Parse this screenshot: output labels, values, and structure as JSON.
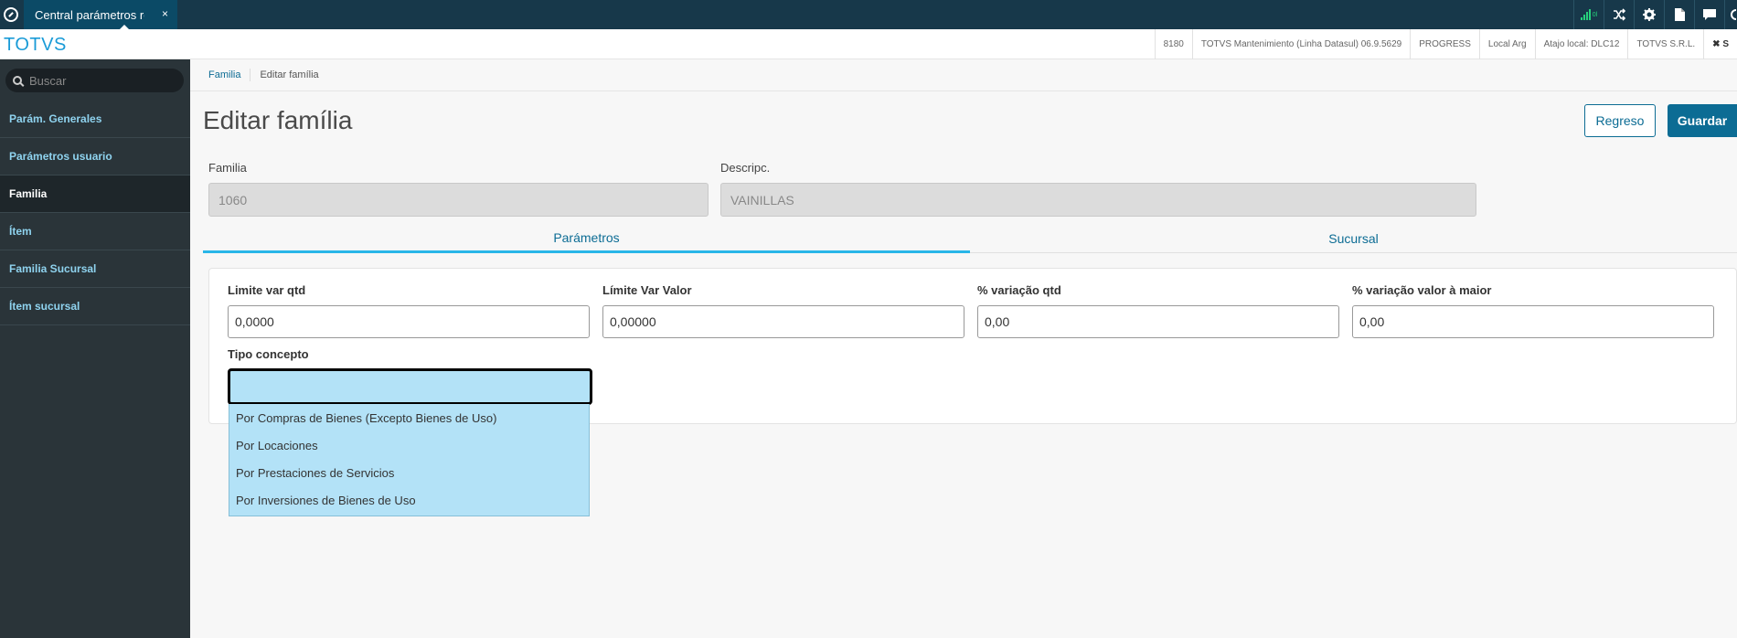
{
  "topbar": {
    "tab_label": "Central parámetros re",
    "tab_close": "×",
    "signal_text": "0l",
    "icons": [
      "signal-icon",
      "shuffle-icon",
      "gear-icon",
      "document-icon",
      "chat-icon",
      "user-icon"
    ]
  },
  "header": {
    "logo": "TOTVS",
    "status": [
      "8180",
      "TOTVS Mantenimiento (Linha Datasul) 06.9.5629",
      "PROGRESS",
      "Local Arg",
      "Atajo local: DLC12",
      "TOTVS S.R.L.",
      "✖ S"
    ]
  },
  "sidebar": {
    "search_placeholder": "Buscar",
    "items": [
      {
        "label": "Parám. Generales"
      },
      {
        "label": "Parámetros usuario"
      },
      {
        "label": "Familia"
      },
      {
        "label": "Ítem"
      },
      {
        "label": "Familia Sucursal"
      },
      {
        "label": "Ítem sucursal"
      }
    ],
    "active_index": 2
  },
  "breadcrumb": {
    "link": "Familia",
    "current": "Editar família"
  },
  "page": {
    "title": "Editar família",
    "back_label": "Regreso",
    "save_label": "Guardar"
  },
  "form": {
    "familia_label": "Familia",
    "familia_value": "1060",
    "descripc_label": "Descripc.",
    "descripc_value": "VAINILLAS"
  },
  "tabs": [
    {
      "label": "Parámetros"
    },
    {
      "label": "Sucursal"
    }
  ],
  "parametros": {
    "limite_var_qtd_label": "Limite var qtd",
    "limite_var_qtd_value": "0,0000",
    "limite_var_valor_label": "Límite Var Valor",
    "limite_var_valor_value": "0,00000",
    "variacao_qtd_label": "% variação qtd",
    "variacao_qtd_value": "0,00",
    "variacao_valor_label": "% variação valor à maior",
    "variacao_valor_value": "0,00",
    "tipo_concepto_label": "Tipo concepto",
    "tipo_concepto_value": "",
    "tipo_concepto_options": [
      "Por Compras de Bienes (Excepto Bienes de Uso)",
      "Por Locaciones",
      "Por Prestaciones de Servicios",
      "Por Inversiones de Bienes de Uso"
    ]
  }
}
